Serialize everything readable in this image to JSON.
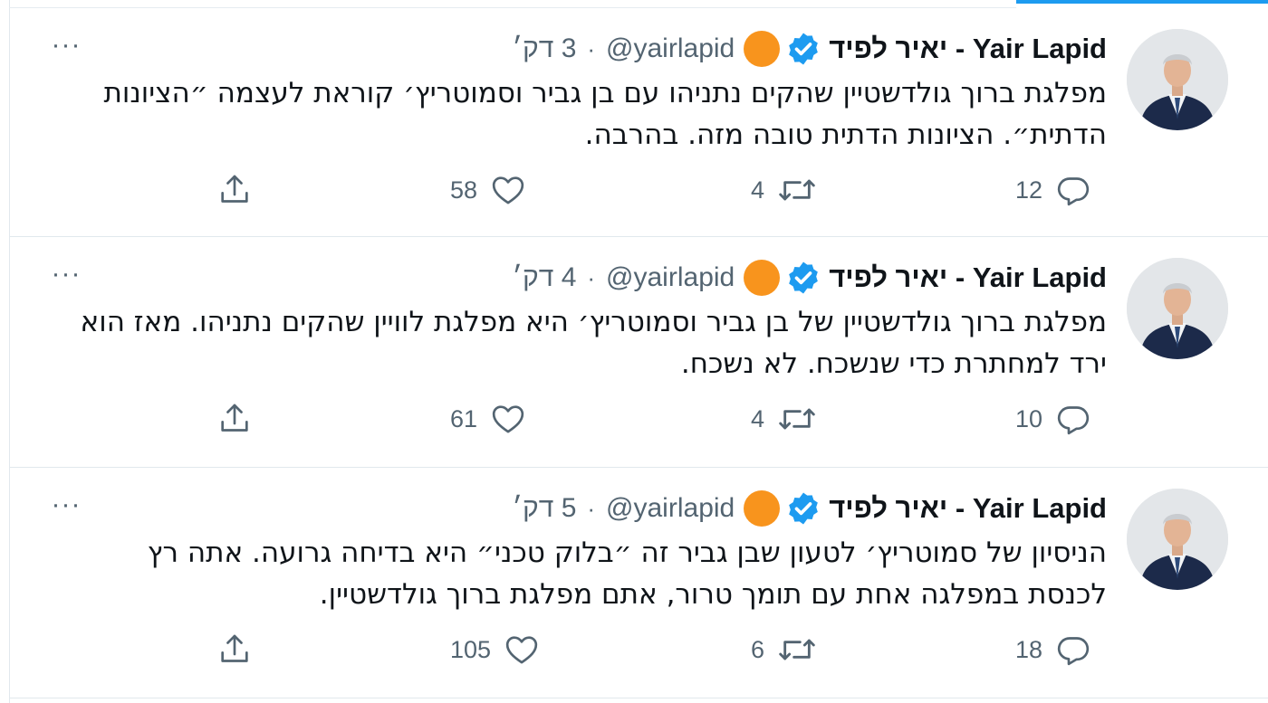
{
  "colors": {
    "accent": "#1d9bf0",
    "text": "#0f1419",
    "muted": "#536471",
    "badge": "#f8941d"
  },
  "tweets": [
    {
      "author": "יאיר לפיד - Yair Lapid",
      "handle": "@yairlapid",
      "separator": "·",
      "time": "3 דק׳",
      "more": "···",
      "text": "מפלגת ברוך גולדשטיין שהקים נתניהו עם בן גביר וסמוטריץ׳ קוראת לעצמה ״הציונות הדתית״. הציונות הדתית טובה מזה. בהרבה.",
      "replies": "12",
      "retweets": "4",
      "likes": "58",
      "icons": {
        "reply": "reply-icon",
        "retweet": "retweet-icon",
        "like": "heart-icon",
        "share": "share-icon"
      }
    },
    {
      "author": "יאיר לפיד - Yair Lapid",
      "handle": "@yairlapid",
      "separator": "·",
      "time": "4 דק׳",
      "more": "···",
      "text": "מפלגת ברוך גולדשטיין של בן גביר וסמוטריץ׳ היא מפלגת לוויין שהקים נתניהו. מאז הוא ירד למחתרת כדי שנשכח. לא נשכח.",
      "replies": "10",
      "retweets": "4",
      "likes": "61",
      "icons": {
        "reply": "reply-icon",
        "retweet": "retweet-icon",
        "like": "heart-icon",
        "share": "share-icon"
      }
    },
    {
      "author": "יאיר לפיד - Yair Lapid",
      "handle": "@yairlapid",
      "separator": "·",
      "time": "5 דק׳",
      "more": "···",
      "text": "הניסיון של סמוטריץ׳ לטעון שבן גביר זה ״בלוק טכני״ היא בדיחה גרועה. אתה רץ לכנסת במפלגה אחת עם תומך טרור, אתם מפלגת ברוך גולדשטיין.",
      "replies": "18",
      "retweets": "6",
      "likes": "105",
      "icons": {
        "reply": "reply-icon",
        "retweet": "retweet-icon",
        "like": "heart-icon",
        "share": "share-icon"
      }
    }
  ]
}
